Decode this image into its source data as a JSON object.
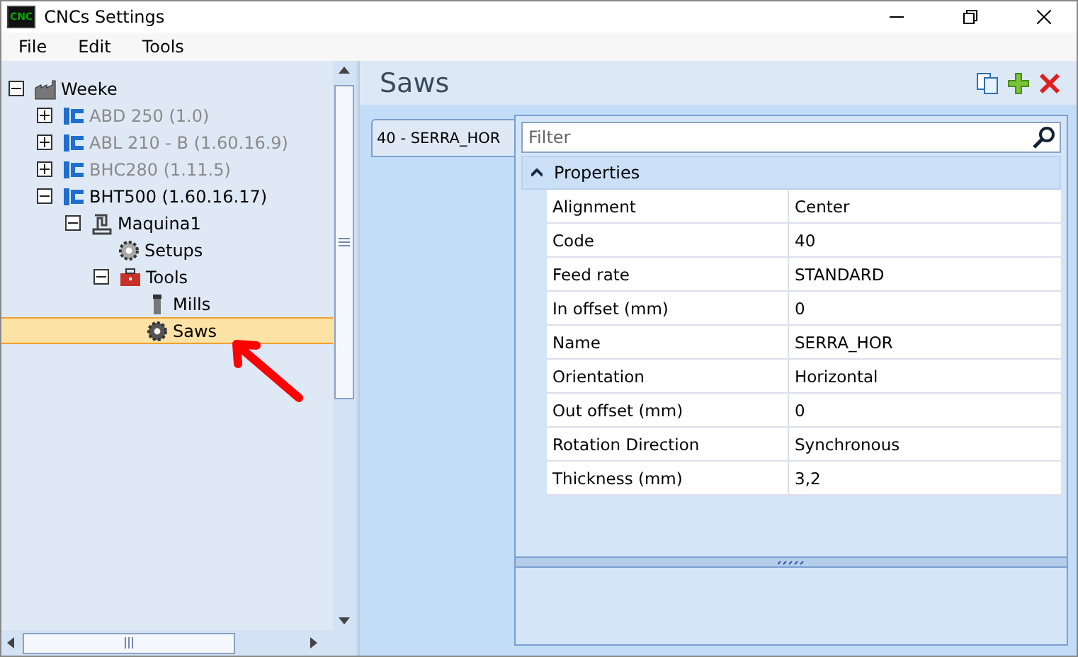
{
  "window": {
    "title": "CNCs Settings",
    "logo": "CNC"
  },
  "menu": [
    "File",
    "Edit",
    "Tools"
  ],
  "tree": [
    {
      "label": "Weeke",
      "kind": "factory",
      "expanded": true,
      "disabled": false,
      "selected": false,
      "children": [
        {
          "label": "ABD 250 (1.0)",
          "kind": "machine-brand",
          "expanded": false,
          "disabled": true,
          "selected": false
        },
        {
          "label": "ABL 210 - B (1.60.16.9)",
          "kind": "machine-brand",
          "expanded": false,
          "disabled": true,
          "selected": false
        },
        {
          "label": "BHC280 (1.11.5)",
          "kind": "machine-brand",
          "expanded": false,
          "disabled": true,
          "selected": false
        },
        {
          "label": "BHT500 (1.60.16.17)",
          "kind": "machine-brand",
          "expanded": true,
          "disabled": false,
          "selected": false,
          "children": [
            {
              "label": "Maquina1",
              "kind": "machine",
              "expanded": true,
              "disabled": false,
              "selected": false,
              "children": [
                {
                  "label": "Setups",
                  "kind": "gear",
                  "disabled": false,
                  "selected": false
                },
                {
                  "label": "Tools",
                  "kind": "toolbox",
                  "expanded": true,
                  "disabled": false,
                  "selected": false,
                  "children": [
                    {
                      "label": "Mills",
                      "kind": "mill",
                      "disabled": false,
                      "selected": false
                    },
                    {
                      "label": "Saws",
                      "kind": "saw",
                      "disabled": false,
                      "selected": true
                    }
                  ]
                }
              ]
            }
          ]
        }
      ]
    }
  ],
  "panel": {
    "title": "Saws",
    "tabs": [
      {
        "label": "40 - SERRA_HOR",
        "selected": true
      }
    ],
    "filter": {
      "placeholder": "Filter"
    },
    "group": {
      "label": "Properties",
      "expanded": true
    },
    "properties": [
      {
        "name": "Alignment",
        "value": "Center"
      },
      {
        "name": "Code",
        "value": "40"
      },
      {
        "name": "Feed rate",
        "value": "STANDARD"
      },
      {
        "name": "In offset (mm)",
        "value": "0"
      },
      {
        "name": "Name",
        "value": "SERRA_HOR"
      },
      {
        "name": "Orientation",
        "value": "Horizontal"
      },
      {
        "name": "Out offset (mm)",
        "value": "0"
      },
      {
        "name": "Rotation Direction",
        "value": "Synchronous"
      },
      {
        "name": "Thickness (mm)",
        "value": "3,2"
      }
    ]
  }
}
